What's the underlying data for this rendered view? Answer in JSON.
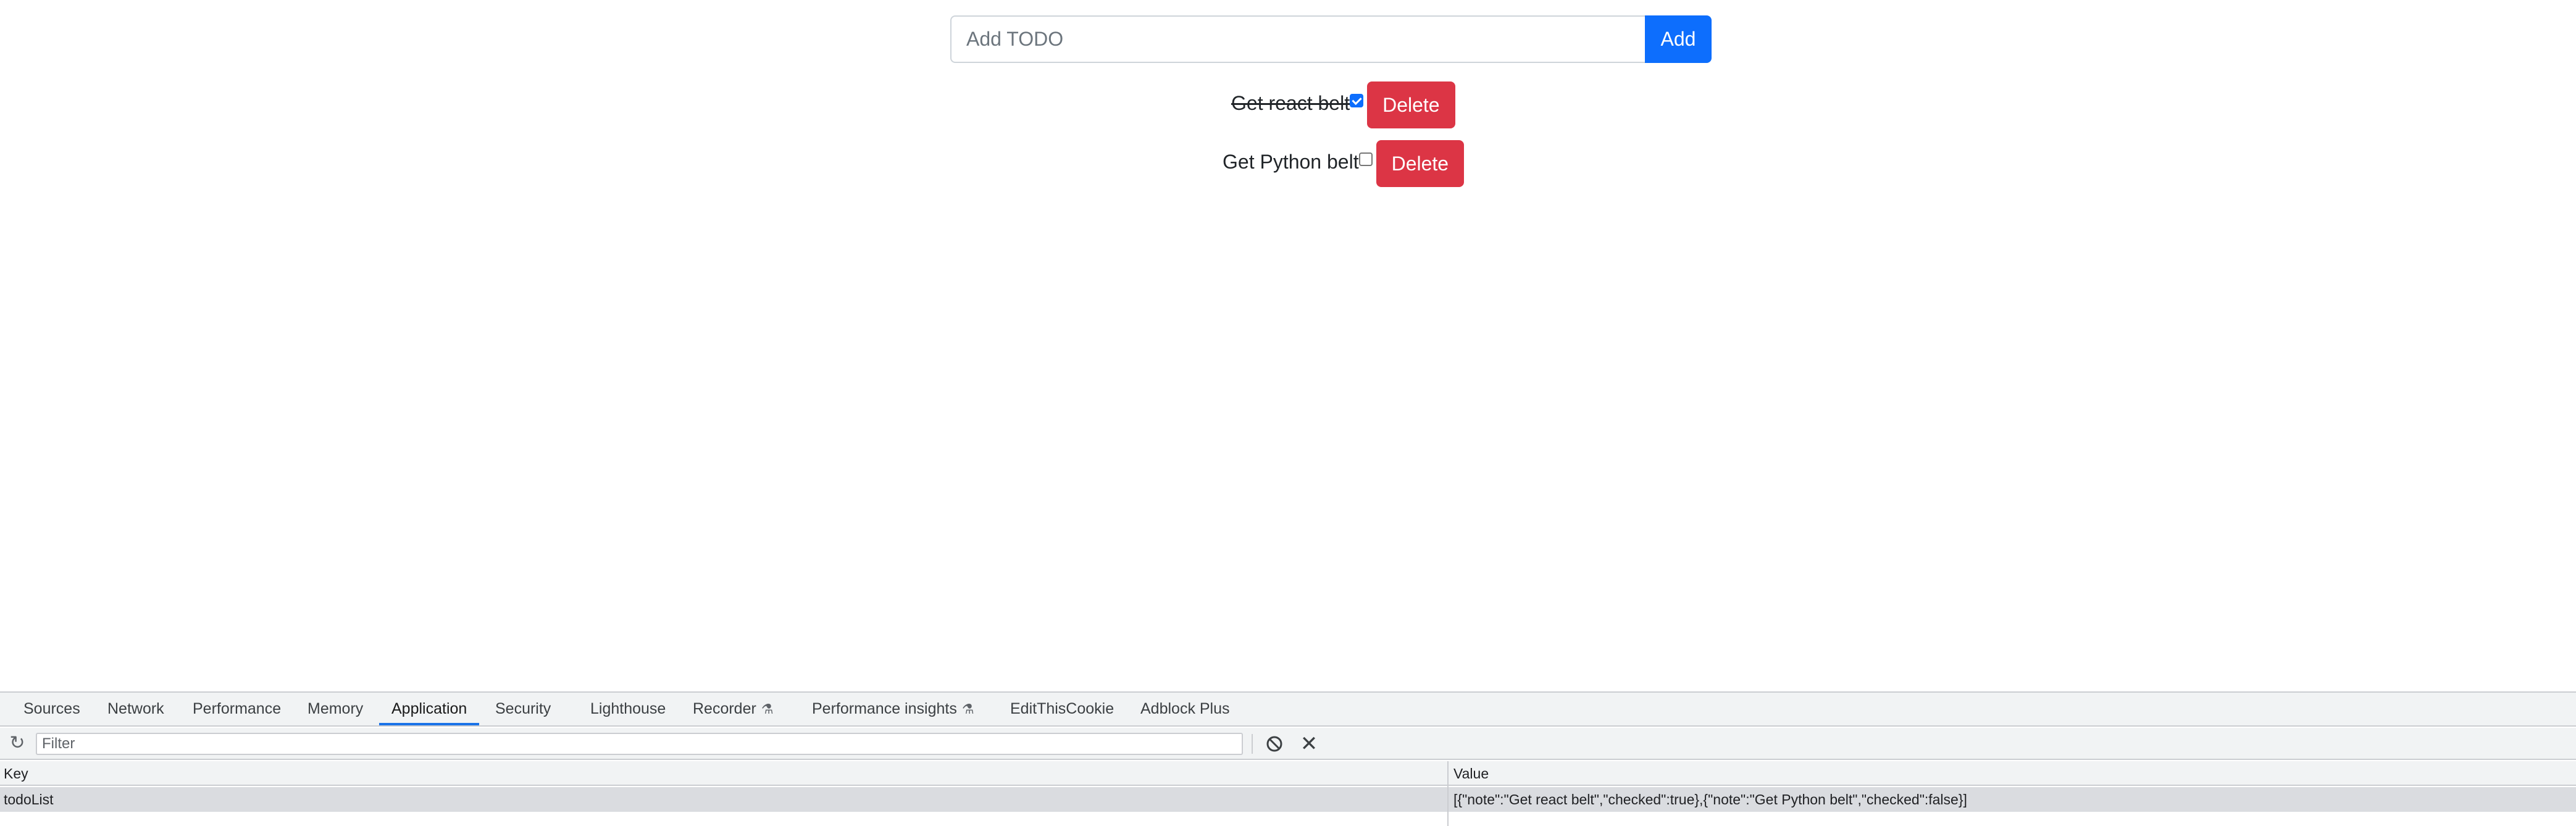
{
  "app": {
    "input": {
      "placeholder": "Add TODO",
      "value": ""
    },
    "add_label": "Add",
    "todos": [
      {
        "note": "Get react belt",
        "checked": true,
        "delete_label": "Delete"
      },
      {
        "note": "Get Python belt",
        "checked": false,
        "delete_label": "Delete"
      }
    ],
    "colors": {
      "primary": "#0d6efd",
      "danger": "#dc3545"
    }
  },
  "devtools": {
    "tabs": [
      {
        "label": "Sources"
      },
      {
        "label": "Network"
      },
      {
        "label": "Performance"
      },
      {
        "label": "Memory"
      },
      {
        "label": "Application",
        "active": true
      },
      {
        "label": "Security"
      },
      {
        "label": "Lighthouse"
      },
      {
        "label": "Recorder",
        "icon": "flask-icon"
      },
      {
        "label": "Performance insights",
        "icon": "flask-icon"
      },
      {
        "label": "EditThisCookie"
      },
      {
        "label": "Adblock Plus"
      }
    ],
    "toolbar": {
      "filter_placeholder": "Filter",
      "icons": [
        "refresh-icon",
        "clear-all-icon",
        "delete-selected-icon"
      ]
    },
    "table": {
      "columns": {
        "key": "Key",
        "value": "Value"
      },
      "rows": [
        {
          "key": "todoList",
          "value": "[{\"note\":\"Get react belt\",\"checked\":true},{\"note\":\"Get Python belt\",\"checked\":false}]"
        }
      ]
    },
    "colors": {
      "active_tab_underline": "#1a73e8"
    }
  }
}
